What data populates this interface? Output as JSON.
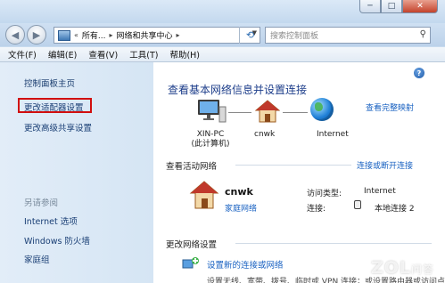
{
  "window": {
    "minimize_glyph": "─",
    "maximize_glyph": "□",
    "close_glyph": "✕"
  },
  "nav": {
    "back_glyph": "◀",
    "forward_glyph": "▶",
    "breadcrumb_sep": "«",
    "breadcrumbs": [
      "所有...",
      "网络和共享中心"
    ],
    "arrow": "▸",
    "dropdown_glyph": "▼",
    "refresh_glyph": "⟲",
    "search_placeholder": "搜索控制面板",
    "search_glyph": "⚲"
  },
  "menu": {
    "items": [
      "文件(F)",
      "编辑(E)",
      "查看(V)",
      "工具(T)",
      "帮助(H)"
    ]
  },
  "left_pane": {
    "home": "控制面板主页",
    "change_adapter": "更改适配器设置",
    "change_advanced": "更改高级共享设置",
    "see_also": "另请参阅",
    "see_also_items": [
      "Internet 选项",
      "Windows 防火墙",
      "家庭组"
    ]
  },
  "main": {
    "help_glyph": "?",
    "title": "查看基本网络信息并设置连接",
    "view_full_map": "查看完整映射",
    "map": {
      "pc_name": "XIN-PC",
      "pc_sub": "(此计算机)",
      "network_name": "cnwk",
      "internet": "Internet"
    },
    "active_networks_header": "查看活动网络",
    "connect_or_disconnect": "连接或断开连接",
    "active": {
      "name": "cnwk",
      "type": "家庭网络",
      "access_type_label": "访问类型:",
      "access_type_value": "Internet",
      "connection_label": "连接:",
      "connection_value": "本地连接 2"
    },
    "change_settings_header": "更改网络设置",
    "setup_link": "设置新的连接或网络",
    "cut_text": "设置无线、宽带、拨号、临时或 VPN 连接；或设置路由器或访问点。"
  },
  "watermark": {
    "brand": "ZOL",
    "sub": "问答"
  },
  "colors": {
    "link": "#1a62c2",
    "title": "#1c3d8a",
    "highlight_box": "#d10f0f"
  }
}
